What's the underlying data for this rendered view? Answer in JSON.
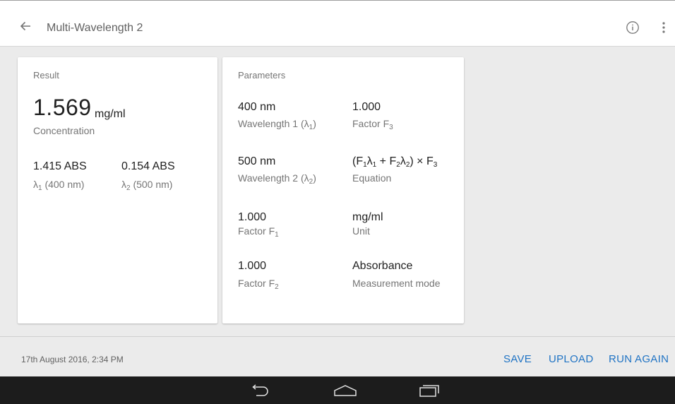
{
  "appbar": {
    "title": "Multi-Wavelength 2",
    "icons": {
      "back": "arrow-back-icon",
      "info": "info-icon",
      "more": "more-vert-icon"
    }
  },
  "result": {
    "heading": "Result",
    "value": "1.569",
    "unit": "mg/ml",
    "label": "Concentration",
    "abs1": {
      "value": "1.415 ABS",
      "label_prefix": "λ",
      "label_sub": "1",
      "label_suffix": " (400 nm)"
    },
    "abs2": {
      "value": "0.154 ABS",
      "label_prefix": "λ",
      "label_sub": "2",
      "label_suffix": " (500 nm)"
    }
  },
  "parameters": {
    "heading": "Parameters",
    "wavelength1": {
      "value": "400 nm",
      "label_prefix": "Wavelength 1 (λ",
      "label_sub": "1",
      "label_suffix": ")"
    },
    "factor3": {
      "value": "1.000",
      "label_prefix": "Factor F",
      "label_sub": "3"
    },
    "wavelength2": {
      "value": "500 nm",
      "label_prefix": "Wavelength 2 (λ",
      "label_sub": "2",
      "label_suffix": ")"
    },
    "equation": {
      "p1": "(F",
      "s1": "1",
      "p2": "λ",
      "s2": "1",
      "p3": " + F",
      "s3": "2",
      "p4": "λ",
      "s4": "2",
      "p5": ") × F",
      "s5": "3",
      "label": "Equation"
    },
    "factor1": {
      "value": "1.000",
      "label_prefix": "Factor F",
      "label_sub": "1"
    },
    "unit": {
      "value": "mg/ml",
      "label": "Unit"
    },
    "factor2": {
      "value": "1.000",
      "label_prefix": "Factor F",
      "label_sub": "2"
    },
    "mode": {
      "value": "Absorbance",
      "label": "Measurement mode"
    }
  },
  "footer": {
    "timestamp": "17th August 2016, 2:34 PM",
    "save": "SAVE",
    "upload": "UPLOAD",
    "run_again": "RUN AGAIN",
    "accent_color": "#1f73c4"
  },
  "navbar": {
    "icons": {
      "back": "nav-back-icon",
      "home": "nav-home-icon",
      "recents": "nav-recents-icon"
    }
  }
}
